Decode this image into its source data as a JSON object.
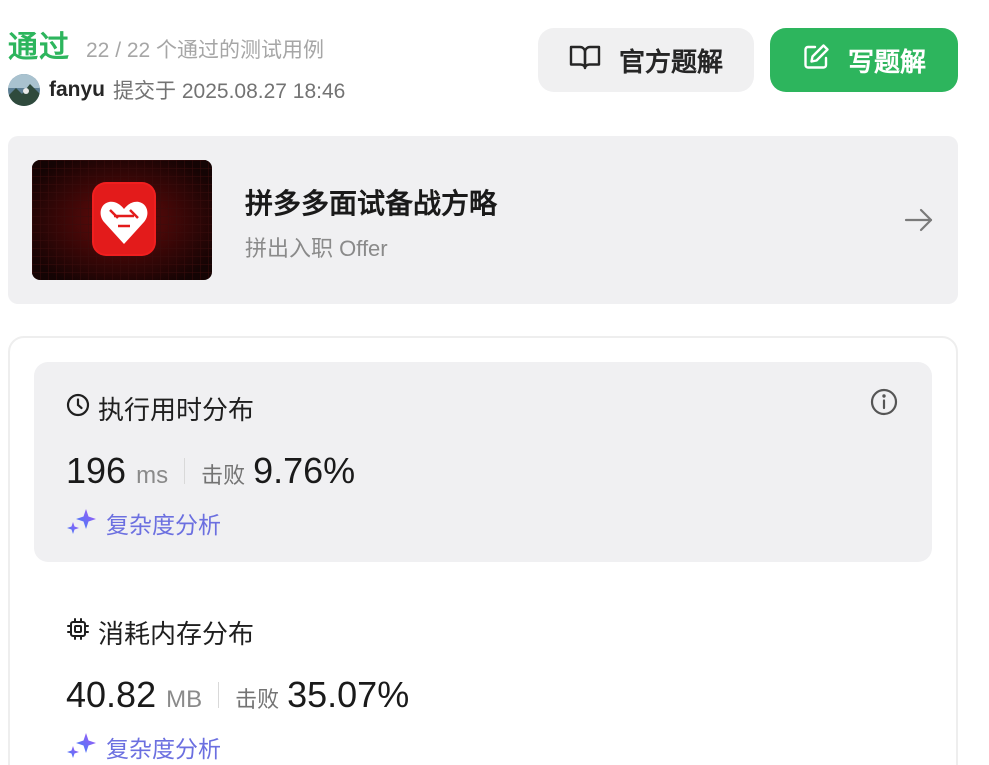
{
  "header": {
    "status": "通过",
    "cases": "22 / 22 个通过的测试用例",
    "username": "fanyu",
    "submit_info": "提交于 2025.08.27 18:46"
  },
  "buttons": {
    "official": "官方题解",
    "write": "写题解"
  },
  "promo": {
    "title": "拼多多面试备战方略",
    "subtitle": "拼出入职 Offer"
  },
  "runtime": {
    "title": "执行用时分布",
    "value": "196",
    "unit": "ms",
    "beat_label": "击败",
    "beat_pct": "9.76%",
    "analysis": "复杂度分析"
  },
  "memory": {
    "title": "消耗内存分布",
    "value": "40.82",
    "unit": "MB",
    "beat_label": "击败",
    "beat_pct": "35.07%",
    "analysis": "复杂度分析"
  },
  "colors": {
    "accepted_green": "#2db55d",
    "analysis_purple": "#6b6fe0",
    "card_bg": "#f0f0f2"
  },
  "icons": [
    "book-icon",
    "edit-icon",
    "arrow-right-icon",
    "clock-icon",
    "info-icon",
    "chip-icon",
    "sparkle-icon"
  ]
}
